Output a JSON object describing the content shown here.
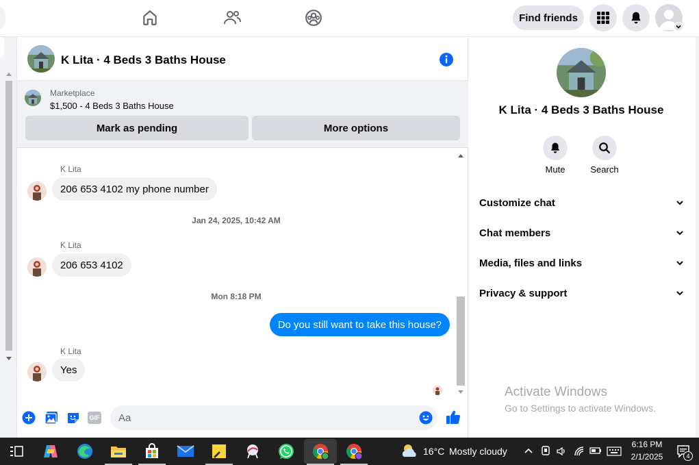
{
  "topnav": {
    "find_friends": "Find friends"
  },
  "chat": {
    "title": "K Lita · 4 Beds 3 Baths House",
    "marketplace": {
      "label": "Marketplace",
      "listing": "$1,500 - 4 Beds 3 Baths House",
      "mark_pending": "Mark as pending",
      "more_options": "More options"
    },
    "messages": [
      {
        "sender": "K Lita",
        "text": "206 653 4102 my phone number"
      },
      {
        "timestamp": "Jan 24, 2025, 10:42 AM"
      },
      {
        "sender": "K Lita",
        "text": "206 653 4102"
      },
      {
        "timestamp": "Mon 8:18 PM"
      },
      {
        "sender": "me",
        "text": "Do you still want to take this house?"
      },
      {
        "sender": "K Lita",
        "text": "Yes"
      }
    ],
    "composer": {
      "placeholder": "Aa",
      "gif": "GIF"
    }
  },
  "right_panel": {
    "title": "K Lita · 4 Beds 3 Baths House",
    "actions": [
      {
        "label": "Mute",
        "icon": "bell-icon"
      },
      {
        "label": "Search",
        "icon": "search-icon"
      }
    ],
    "sections": [
      {
        "label": "Customize chat"
      },
      {
        "label": "Chat members"
      },
      {
        "label": "Media, files and links"
      },
      {
        "label": "Privacy & support"
      }
    ],
    "watermark_title": "Activate Windows",
    "watermark_sub": "Go to Settings to activate Windows."
  },
  "taskbar": {
    "weather_temp": "16°C",
    "weather_desc": "Mostly cloudy",
    "time": "6:16 PM",
    "date": "2/1/2025",
    "notification_count": "4"
  },
  "colors": {
    "messenger_blue": "#0084ff",
    "fb_blue": "#0866ff"
  }
}
